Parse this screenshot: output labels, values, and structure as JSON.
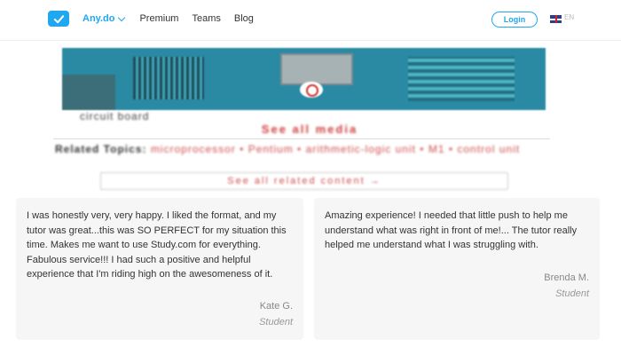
{
  "header": {
    "brand_label": "Any.do",
    "nav_items": [
      "Premium",
      "Teams",
      "Blog"
    ],
    "login_label": "Login",
    "language": "EN"
  },
  "embedded_page": {
    "caption": "circuit board",
    "see_all_media": "See all media",
    "related_heading": "Related Topics:",
    "related_topics": "microprocessor • Pentium • arithmetic-logic unit • M1 • control unit",
    "see_all_related": "See all related content →"
  },
  "reviews": [
    {
      "text": "I was honestly very, very happy. I liked the format, and my tutor was great...this was SO PERFECT for my situation this time. Makes me want to use Study.com for everything. Fabulous service!!! I had such a positive and helpful experience that I'm riding high on the awesomeness of it.",
      "name": "Kate G.",
      "role": "Student"
    },
    {
      "text": "Amazing experience! I needed that little push to help me understand what was right in front of me!... The tutor really helped me understand what I was struggling with.",
      "name": "Brenda M.",
      "role": "Student"
    }
  ],
  "colors": {
    "accent": "#1fa7f0",
    "link_red": "#cf3c3c",
    "card_bg": "#f6f6f6"
  }
}
